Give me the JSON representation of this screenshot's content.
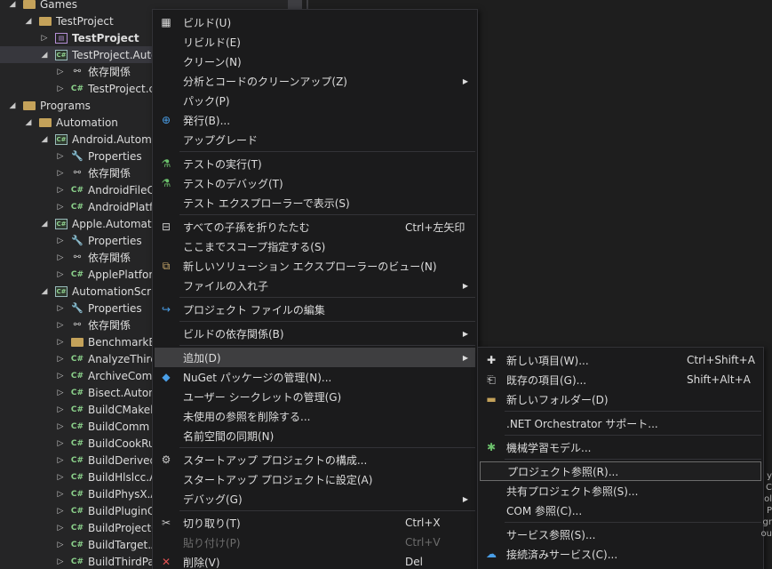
{
  "tree": [
    {
      "label": "Games",
      "icon": "folder",
      "chev": "◢",
      "indent": 1,
      "bold": false
    },
    {
      "label": "TestProject",
      "icon": "folder",
      "chev": "◢",
      "indent": 2,
      "bold": false
    },
    {
      "label": "TestProject",
      "icon": "uproj",
      "chev": "▷",
      "indent": 3,
      "bold": true
    },
    {
      "label": "TestProject.Automation",
      "icon": "proj",
      "chev": "◢",
      "indent": 3,
      "bold": false,
      "selected": true
    },
    {
      "label": "依存関係",
      "icon": "deps",
      "chev": "▷",
      "indent": 4,
      "bold": false
    },
    {
      "label": "TestProject.cs",
      "icon": "cs",
      "chev": "▷",
      "indent": 4,
      "bold": false
    },
    {
      "label": "Programs",
      "icon": "folder",
      "chev": "◢",
      "indent": 1,
      "bold": false
    },
    {
      "label": "Automation",
      "icon": "folder",
      "chev": "◢",
      "indent": 2,
      "bold": false
    },
    {
      "label": "Android.Automation",
      "icon": "proj",
      "chev": "◢",
      "indent": 3,
      "bold": false
    },
    {
      "label": "Properties",
      "icon": "props",
      "chev": "▷",
      "indent": 4,
      "bold": false
    },
    {
      "label": "依存関係",
      "icon": "deps",
      "chev": "▷",
      "indent": 4,
      "bold": false
    },
    {
      "label": "AndroidFileC",
      "icon": "cs",
      "chev": "▷",
      "indent": 4,
      "bold": false
    },
    {
      "label": "AndroidPlatf",
      "icon": "cs",
      "chev": "▷",
      "indent": 4,
      "bold": false
    },
    {
      "label": "Apple.Automation",
      "icon": "proj",
      "chev": "◢",
      "indent": 3,
      "bold": false
    },
    {
      "label": "Properties",
      "icon": "props",
      "chev": "▷",
      "indent": 4,
      "bold": false
    },
    {
      "label": "依存関係",
      "icon": "deps",
      "chev": "▷",
      "indent": 4,
      "bold": false
    },
    {
      "label": "ApplePlatfor",
      "icon": "cs",
      "chev": "▷",
      "indent": 4,
      "bold": false
    },
    {
      "label": "AutomationScripts",
      "icon": "proj",
      "chev": "◢",
      "indent": 3,
      "bold": false
    },
    {
      "label": "Properties",
      "icon": "props",
      "chev": "▷",
      "indent": 4,
      "bold": false
    },
    {
      "label": "依存関係",
      "icon": "deps",
      "chev": "▷",
      "indent": 4,
      "bold": false
    },
    {
      "label": "BenchmarkB",
      "icon": "folder",
      "chev": "▷",
      "indent": 4,
      "bold": false
    },
    {
      "label": "AnalyzeThirc",
      "icon": "cs",
      "chev": "▷",
      "indent": 4,
      "bold": false
    },
    {
      "label": "ArchiveComr",
      "icon": "cs",
      "chev": "▷",
      "indent": 4,
      "bold": false
    },
    {
      "label": "Bisect.Auton",
      "icon": "cs",
      "chev": "▷",
      "indent": 4,
      "bold": false
    },
    {
      "label": "BuildCMakel",
      "icon": "cs",
      "chev": "▷",
      "indent": 4,
      "bold": false
    },
    {
      "label": "BuildComm",
      "icon": "cs",
      "chev": "▷",
      "indent": 4,
      "bold": false
    },
    {
      "label": "BuildCookRu",
      "icon": "cs",
      "chev": "▷",
      "indent": 4,
      "bold": false
    },
    {
      "label": "BuildDerived",
      "icon": "cs",
      "chev": "▷",
      "indent": 4,
      "bold": false
    },
    {
      "label": "BuildHlslcc.A",
      "icon": "cs",
      "chev": "▷",
      "indent": 4,
      "bold": false
    },
    {
      "label": "BuildPhysX.A",
      "icon": "cs",
      "chev": "▷",
      "indent": 4,
      "bold": false
    },
    {
      "label": "BuildPluginC",
      "icon": "cs",
      "chev": "▷",
      "indent": 4,
      "bold": false
    },
    {
      "label": "BuildProjectC",
      "icon": "cs",
      "chev": "▷",
      "indent": 4,
      "bold": false
    },
    {
      "label": "BuildTarget.A",
      "icon": "cs",
      "chev": "▷",
      "indent": 4,
      "bold": false
    },
    {
      "label": "BuildThirdPa",
      "icon": "cs",
      "chev": "▷",
      "indent": 4,
      "bold": false
    }
  ],
  "menu": {
    "items": [
      {
        "label": "ビルド(U)",
        "icon": "build-icon",
        "glyph": "▦",
        "color": "#dcdcdc"
      },
      {
        "label": "リビルド(E)"
      },
      {
        "label": "クリーン(N)"
      },
      {
        "label": "分析とコードのクリーンアップ(Z)",
        "arrow": true
      },
      {
        "label": "パック(P)"
      },
      {
        "label": "発行(B)...",
        "icon": "globe-icon",
        "glyph": "⊕",
        "color": "#4a9fe8"
      },
      {
        "label": "アップグレード"
      },
      {
        "sep": true
      },
      {
        "label": "テストの実行(T)",
        "icon": "run-test-icon",
        "glyph": "⚗",
        "color": "#6cc16c"
      },
      {
        "label": "テストのデバッグ(T)",
        "icon": "debug-test-icon",
        "glyph": "⚗",
        "color": "#6cc16c"
      },
      {
        "label": "テスト エクスプローラーで表示(S)"
      },
      {
        "sep": true
      },
      {
        "label": "すべての子孫を折りたたむ",
        "shortcut": "Ctrl+左矢印",
        "icon": "collapse-icon",
        "glyph": "⊟",
        "color": "#c8c8c8"
      },
      {
        "label": "ここまでスコープ指定する(S)"
      },
      {
        "label": "新しいソリューション エクスプローラーのビュー(N)",
        "icon": "new-view-icon",
        "glyph": "⧉",
        "color": "#c8a86a"
      },
      {
        "label": "ファイルの入れ子",
        "arrow": true
      },
      {
        "sep": true
      },
      {
        "label": "プロジェクト ファイルの編集",
        "icon": "edit-project-icon",
        "glyph": "↪",
        "color": "#4a9fe8"
      },
      {
        "sep": true
      },
      {
        "label": "ビルドの依存関係(B)",
        "arrow": true
      },
      {
        "sep": true
      },
      {
        "label": "追加(D)",
        "arrow": true,
        "active": true
      },
      {
        "label": "NuGet パッケージの管理(N)...",
        "icon": "nuget-icon",
        "glyph": "◆",
        "color": "#4a9fe8"
      },
      {
        "label": "ユーザー シークレットの管理(G)"
      },
      {
        "label": "未使用の参照を削除する..."
      },
      {
        "label": "名前空間の同期(N)"
      },
      {
        "sep": true
      },
      {
        "label": "スタートアップ プロジェクトの構成...",
        "icon": "gear-icon",
        "glyph": "⚙",
        "color": "#c8c8c8"
      },
      {
        "label": "スタートアップ プロジェクトに設定(A)"
      },
      {
        "label": "デバッグ(G)",
        "arrow": true
      },
      {
        "sep": true
      },
      {
        "label": "切り取り(T)",
        "shortcut": "Ctrl+X",
        "icon": "scissors-icon",
        "glyph": "✂",
        "color": "#c8c8c8"
      },
      {
        "label": "貼り付け(P)",
        "shortcut": "Ctrl+V",
        "icon": "paste-icon",
        "glyph": "",
        "color": "#6d6d6d",
        "disabled": true
      },
      {
        "label": "削除(V)",
        "shortcut": "Del",
        "icon": "delete-icon",
        "glyph": "✕",
        "color": "#e05252"
      }
    ]
  },
  "submenu": {
    "items": [
      {
        "label": "新しい項目(W)...",
        "shortcut": "Ctrl+Shift+A",
        "icon": "new-item-icon",
        "glyph": "✚",
        "color": "#dcdcdc"
      },
      {
        "label": "既存の項目(G)...",
        "shortcut": "Shift+Alt+A",
        "icon": "existing-item-icon",
        "glyph": "⎗",
        "color": "#dcdcdc"
      },
      {
        "label": "新しいフォルダー(D)",
        "icon": "new-folder-icon",
        "glyph": "▬",
        "color": "#c4a25a"
      },
      {
        "sep": true
      },
      {
        "label": ".NET Orchestrator サポート..."
      },
      {
        "sep": true
      },
      {
        "label": "機械学習モデル...",
        "icon": "ml-model-icon",
        "glyph": "✱",
        "color": "#6cc16c"
      },
      {
        "sep": true
      },
      {
        "label": "プロジェクト参照(R)...",
        "highlight": true
      },
      {
        "label": "共有プロジェクト参照(S)..."
      },
      {
        "label": "COM 参照(C)..."
      },
      {
        "sep": true
      },
      {
        "label": "サービス参照(S)..."
      },
      {
        "label": "接続済みサービス(C)...",
        "icon": "connected-service-icon",
        "glyph": "☁",
        "color": "#4a9fe8"
      }
    ]
  },
  "bg_fragments": [
    "y",
    "C",
    "ol",
    "P",
    "gr",
    "ou"
  ]
}
